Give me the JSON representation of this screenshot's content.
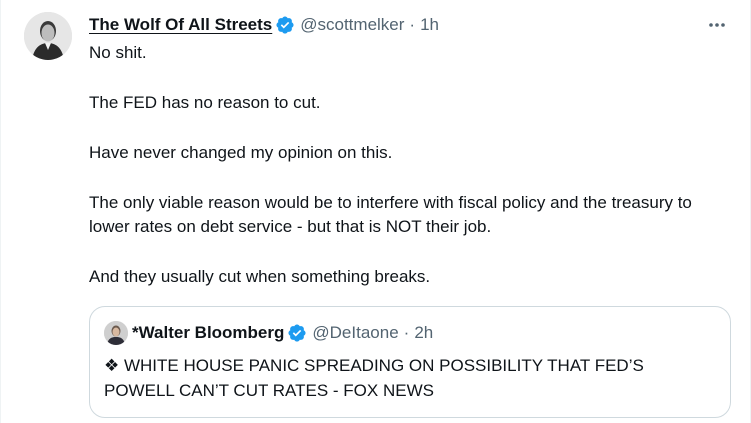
{
  "tweet": {
    "author": {
      "display_name": "The Wolf Of All Streets",
      "handle": "@scottmelker",
      "verified": true,
      "time": "1h",
      "separator": "·"
    },
    "text": [
      "No shit.",
      "The FED has no reason to cut.",
      "Have never changed my opinion on this.",
      "The only viable reason would be to interfere with fiscal policy and the treasury to lower rates on debt service - but that is NOT their job.",
      "And they usually cut when something breaks."
    ],
    "more_icon": "more-horizontal-icon"
  },
  "quoted_tweet": {
    "author": {
      "display_name": "*Walter Bloomberg",
      "handle": "@DeItaone",
      "verified": true,
      "time": "2h",
      "separator": "·"
    },
    "text": "❖ WHITE HOUSE PANIC SPREADING ON POSSIBILITY THAT FED’S POWELL CAN’T CUT RATES - FOX NEWS"
  },
  "colors": {
    "verified_blue": "#1d9bf0",
    "secondary_text": "#536471",
    "border": "#cfd9de"
  }
}
